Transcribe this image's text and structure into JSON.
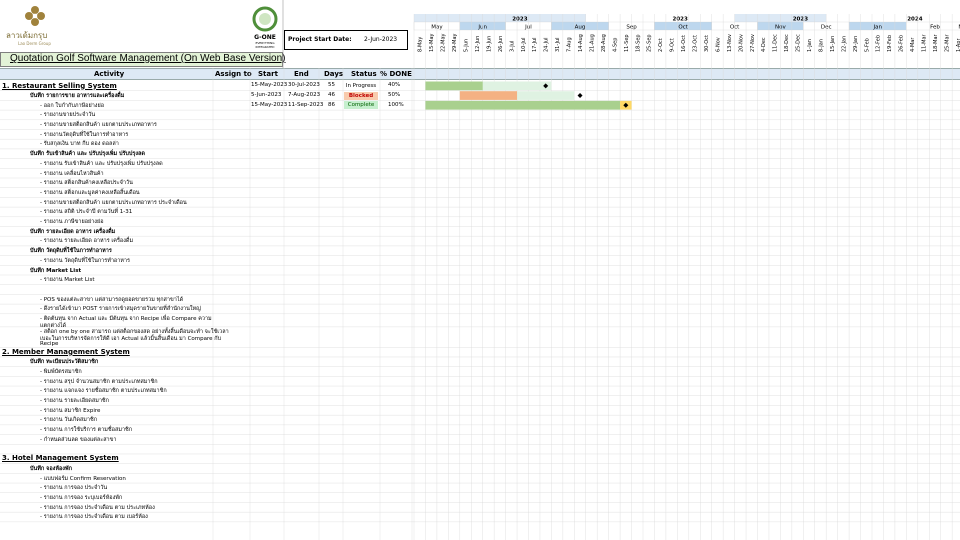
{
  "header": {
    "logo_text": "ลาวเด้มกรุบ",
    "logo_sub": "Lao Derm Group",
    "gone_text": "G-ONE",
    "gone_sub": "EVERYTHING INTEGRATED",
    "project_start_label": "Project Start Date:",
    "project_start_value": "2-Jun-2023",
    "title": "Quotation Golf Software Management (On Web Base Version)"
  },
  "columns": {
    "activity": "Activity",
    "assign": "Assign to",
    "start": "Start",
    "end": "End",
    "days": "Days",
    "status": "Status",
    "done": "% DONE"
  },
  "colors": {
    "done_green": "#a9d08e",
    "done_light": "#dff2e2",
    "blocked_bar": "#f4b183",
    "today_marker": "#ffd966",
    "header_blue": "#bdd7ee",
    "in_progress_bg": "#ffffff",
    "blocked_bg": "#f8cbad",
    "blocked_text": "#c00000",
    "complete_bg": "#c6efce",
    "complete_text": "#006100"
  },
  "timeline": {
    "years": [
      "2023",
      "2023",
      "2023",
      "2024"
    ],
    "months": [
      "May",
      "Jun",
      "Jul",
      "Aug",
      "Sep",
      "Oct",
      "Oct",
      "Nov",
      "Dec",
      "Jan",
      "Feb",
      "Mar"
    ],
    "weeks": [
      "8-May",
      "15-May",
      "22-May",
      "29-May",
      "5-Jun",
      "12-Jun",
      "19-Jun",
      "26-Jun",
      "3-Jul",
      "10-Jul",
      "17-Jul",
      "24-Jul",
      "31-Jul",
      "7-Aug",
      "14-Aug",
      "21-Aug",
      "28-Aug",
      "4-Sep",
      "11-Sep",
      "18-Sep",
      "25-Sep",
      "2-Oct",
      "9-Oct",
      "16-Oct",
      "23-Oct",
      "30-Oct",
      "6-Nov",
      "13-Nov",
      "20-Nov",
      "27-Nov",
      "4-Dec",
      "11-Dec",
      "18-Dec",
      "25-Dec",
      "1-Jan",
      "8-Jan",
      "15-Jan",
      "22-Jan",
      "29-Jan",
      "5-Feb",
      "12-Feb",
      "19-Feb",
      "26-Feb",
      "4-Mar",
      "11-Mar",
      "18-Mar",
      "25-Mar",
      "1-Apr"
    ]
  },
  "rows": [
    {
      "text": "1. Restaurant Selling System",
      "level": "section",
      "start": "15-May-2023",
      "end": "30-Jul-2023",
      "days": "55",
      "status": "In Progress",
      "done": "40%",
      "bar_start": 1,
      "bar_len": 11,
      "done_weeks": 5,
      "bar_kind": "progress",
      "marker": 11
    },
    {
      "text": "บันทึก รายการขาย อาหารและเครื่องดื่ม",
      "level": "sub",
      "start": "5-Jun-2023",
      "end": "7-Aug-2023",
      "days": "46",
      "status": "Blocked",
      "done": "50%",
      "bar_start": 4,
      "bar_len": 10,
      "done_weeks": 5,
      "bar_kind": "blocked",
      "marker": 14
    },
    {
      "text": "- ออก ใบกำกับภาษีอย่างย่อ",
      "level": "item",
      "start": "15-May-2023",
      "end": "11-Sep-2023",
      "days": "86",
      "status": "Complete",
      "done": "100%",
      "bar_start": 1,
      "bar_len": 17,
      "done_weeks": 17,
      "bar_kind": "complete",
      "marker": 18
    },
    {
      "text": "- รายงานขายประจำวัน",
      "level": "item"
    },
    {
      "text": "- รายงานขายสต็อกสินค้า แยกตามประเภทอาหาร",
      "level": "item"
    },
    {
      "text": "- รายงานวัตถุดิบที่ใช้ในการทำอาหาร",
      "level": "item"
    },
    {
      "text": "- รับสกุลเงิน บาท กีบ ดอง ดอลล่า",
      "level": "item"
    },
    {
      "text": "บันทึก รับเข้าสินค้า และ ปรับปรุงเพิ่ม ปรับปรุงลด",
      "level": "sub"
    },
    {
      "text": "- รายงาน รับเข้าสินค้า และ ปรับปรุงเพิ่ม ปรับปรุงลด",
      "level": "item"
    },
    {
      "text": "- รายงาน เคลื่อนไหวสินค้า",
      "level": "item"
    },
    {
      "text": "- รายงาน สต็อกสินค้าคงเหลือประจำวัน",
      "level": "item"
    },
    {
      "text": "- รายงาน สต็อกและมูลค่าคงเหลือสิ้นเดือน",
      "level": "item"
    },
    {
      "text": "- รายงานขายสต็อกสินค้า แยกตามประเภทอาหาร ประจำเดือน",
      "level": "item"
    },
    {
      "text": "- รายงาน สถิติ ประจำปี ตามวันที่ 1-31",
      "level": "item"
    },
    {
      "text": "- รายงาน ภาษีขายอย่างย่อ",
      "level": "item"
    },
    {
      "text": "บันทึก รายละเอียด อาหาร เครื่องดื่ม",
      "level": "sub"
    },
    {
      "text": "- รายงาน รายละเอียด อาหาร เครื่องดื่ม",
      "level": "item"
    },
    {
      "text": "บันทึก วัตถุดิบที่ใช้ในการทำอาหาร",
      "level": "sub"
    },
    {
      "text": "- รายงาน วัตถุดิบที่ใช้ในการทำอาหาร",
      "level": "item"
    },
    {
      "text": "บันทึก Market List",
      "level": "sub"
    },
    {
      "text": "- รายงาน Market List",
      "level": "item"
    },
    {
      "text": "",
      "level": "item"
    },
    {
      "text": "- POS ของแต่ละสาขา แต่สามารถดูยอดขายรวม ทุกสาขาได้",
      "level": "item"
    },
    {
      "text": "- ดึงรายได้เข้ามา POST รายการเข้าสมุดรายวันขายที่สำนักงานใหญ่",
      "level": "item"
    },
    {
      "text": "- ติดต้นทุน จาก Actual และ มีต้นทุน จาก Recipe เพื่อ Compare ความแตกต่างได้",
      "level": "item",
      "wrap": [
        "- ติดต้นทุน จาก Actual และ มีต้นทุน จาก Recipe เพื่อ Compare ความ",
        "แตกต่างได้"
      ]
    },
    {
      "text": "- สต็อก one by one สามารถ แต่สต็อกของสด อย่างทั้งสิ้นเดือนจะทำ จะใช้เวลาเบอะในการบริหารจัดการให้ดี เอา Actual แล้วมิ้นสิ้นเดือน มา Compare กับ Recipe",
      "level": "item",
      "wrap": [
        "- สต็อก one by one สามารถ แต่สต็อกของสด อย่างทั้งสิ้นเดือนจะทำ จะใช้เวลา",
        "เบอะในการบริหารจัดการให้ดี เอา Actual แล้วมิ้นสิ้นเดือน มา Compare กับ",
        "Recipe"
      ]
    },
    {
      "text": "2. Member Management System",
      "level": "section"
    },
    {
      "text": "บันทึก ทะเบียนประวัติสมาชิก",
      "level": "sub"
    },
    {
      "text": "- พิมพ์บัตรสมาชิก",
      "level": "item"
    },
    {
      "text": "- รายงาน สรุป จำนวนสมาชิก ตามประเภทสมาชิก",
      "level": "item"
    },
    {
      "text": "- รายงาน แจกแจง รายชื่อสมาชิก ตามประเภทสมาชิก",
      "level": "item"
    },
    {
      "text": "- รายงาน รายละเอียดสมาชิก",
      "level": "item"
    },
    {
      "text": "- รายงาน สมาชิก Expire",
      "level": "item"
    },
    {
      "text": "- รายงาน วันเกิดสมาชิก",
      "level": "item"
    },
    {
      "text": "- รายงาน การใช้บริการ ตามชื่อสมาชิก",
      "level": "item"
    },
    {
      "text": "- กำหนดส่วนลด ของแต่ละสาขา",
      "level": "item"
    },
    {
      "text": "",
      "level": "item"
    },
    {
      "text": "3. Hotel Management System",
      "level": "section"
    },
    {
      "text": "บันทึก จองห้องพัก",
      "level": "sub"
    },
    {
      "text": "- แบบฟอร์ม Confirm Reservation",
      "level": "item"
    },
    {
      "text": "- รายงาน การจอง ประจำวัน",
      "level": "item"
    },
    {
      "text": "- รายงาน การจอง ระบุเบอร์ห้องพัก",
      "level": "item"
    },
    {
      "text": "- รายงาน การจอง ประจำเดือน ตาม ประเภทห้อง",
      "level": "item"
    },
    {
      "text": "- รายงาน การจอง ประจำเดือน ตาม เบอร์ห้อง",
      "level": "item"
    }
  ]
}
